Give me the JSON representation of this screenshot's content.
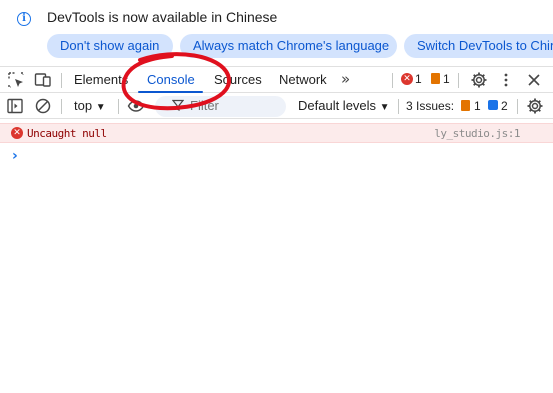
{
  "infobar": {
    "message": "DevTools is now available in Chinese",
    "buttons": [
      "Don't show again",
      "Always match Chrome's language",
      "Switch DevTools to Chinese"
    ]
  },
  "toolbar": {
    "tabs": [
      "Elements",
      "Console",
      "Sources",
      "Network"
    ],
    "active_tab": "Console",
    "error_count": "1",
    "warning_count": "1"
  },
  "console_toolbar": {
    "context": "top",
    "filter_placeholder": "Filter",
    "levels": "Default levels",
    "issues_label": "3 Issues:",
    "issues_warning": "1",
    "issues_info": "2"
  },
  "console": {
    "error_message": "Uncaught null",
    "error_source": "ly_studio.js:1"
  },
  "colors": {
    "accent": "#0b57d0",
    "error": "#dc362e",
    "warning": "#e37400",
    "annotation": "#e0101e"
  }
}
